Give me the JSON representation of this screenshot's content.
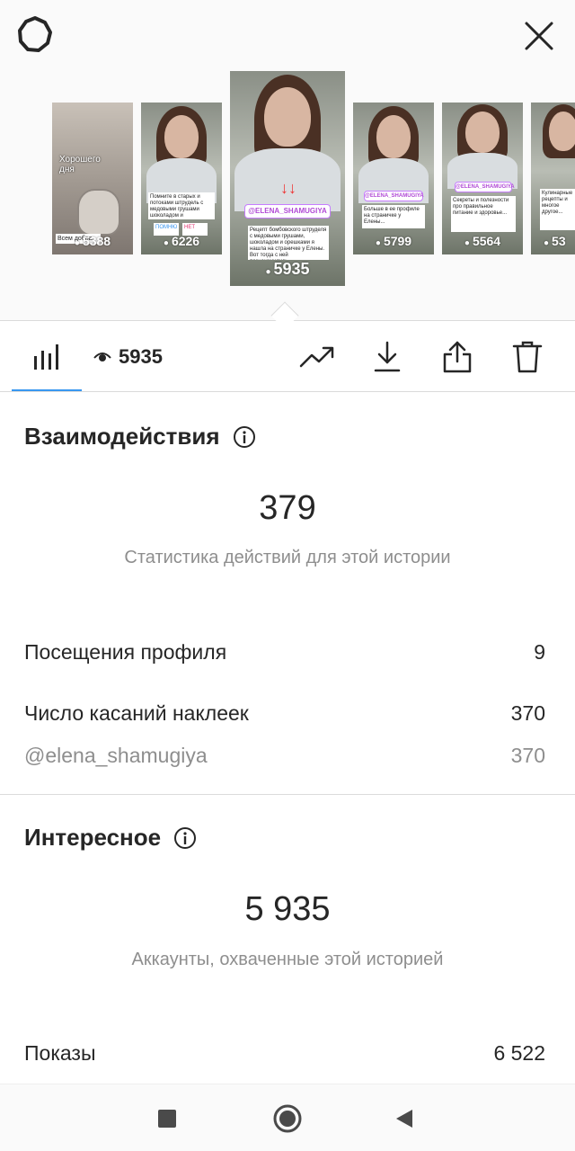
{
  "stories": [
    {
      "views": "5388",
      "overlay_top": "Хорошего дня",
      "overlay_bottom": "Всем добра"
    },
    {
      "views": "6226",
      "caption": "Помните в старых и потоками штрудель с медовыми грушами шоколадом и орешками??",
      "reply_left": "ПОМНЮ",
      "reply_right": "НЕТ"
    },
    {
      "views": "5935",
      "tag": "@ELENA_SHAMUGIYA",
      "caption": "Рецепт бомбовского штруделя с медовыми грушами, шоколадом и орешками я нашла на страничке у Елены. Вот тогда с ней познакомились..."
    },
    {
      "views": "5799",
      "tag": "@ELENA_SHAMUGIYA",
      "caption": "Больше в ее профиле на страничке у Елены..."
    },
    {
      "views": "5564",
      "tag": "@ELENA_SHAMUGIYA",
      "caption": "Секреты и полезности про правильное питание и здоровье..."
    },
    {
      "views": "53",
      "tag": "",
      "caption": "Кулинарные рецепты и многое другое..."
    }
  ],
  "toolbar": {
    "views": "5935",
    "icons": [
      "bar-chart-icon",
      "eye-icon",
      "trending-icon",
      "download-icon",
      "share-icon",
      "trash-icon"
    ]
  },
  "interactions": {
    "title": "Взаимодействия",
    "total": "379",
    "subtitle": "Статистика действий для этой истории",
    "rows": [
      {
        "label": "Посещения профиля",
        "value": "9"
      },
      {
        "label": "Число касаний наклеек",
        "value": "370"
      },
      {
        "label": "@elena_shamugiya",
        "value": "370"
      }
    ]
  },
  "discovery": {
    "title": "Интересное",
    "total": "5 935",
    "subtitle": "Аккаунты, охваченные этой историей",
    "rows": [
      {
        "label": "Показы",
        "value": "6 522"
      }
    ]
  },
  "colors": {
    "accent": "#3897f0",
    "text": "#262626",
    "muted": "#8e8e8e",
    "divider": "#dbdbdb"
  }
}
